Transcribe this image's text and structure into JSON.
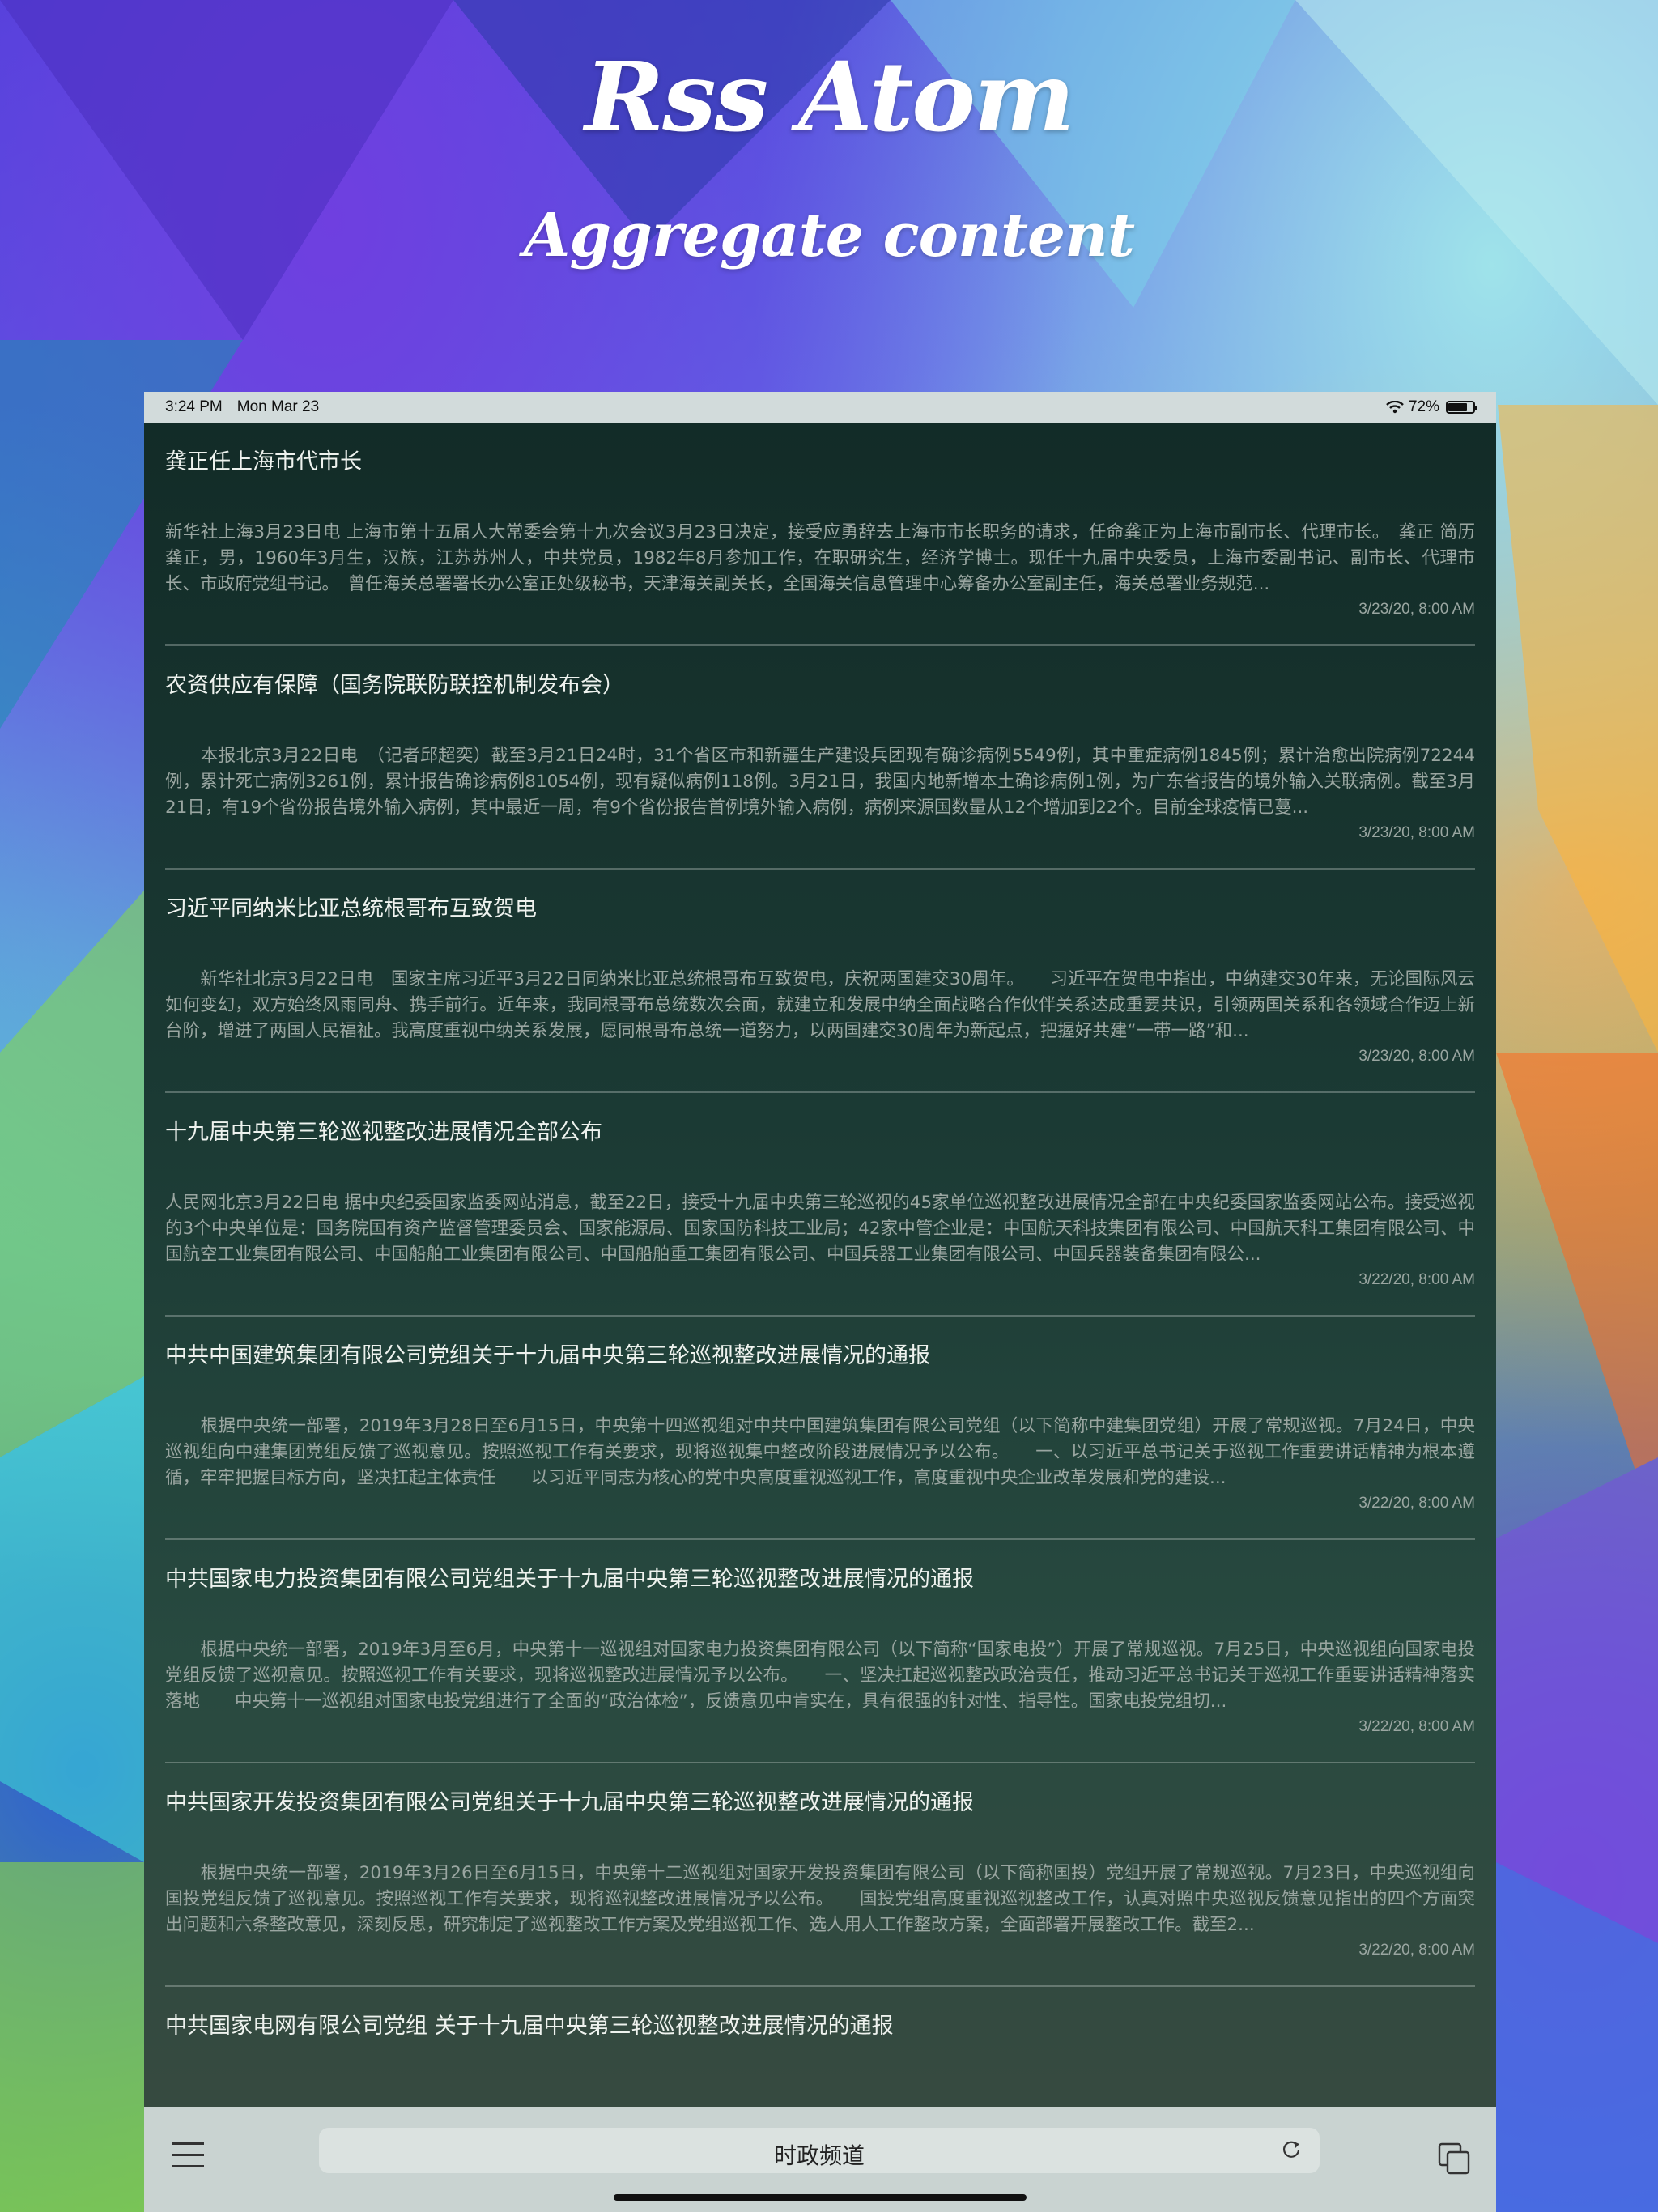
{
  "hero": {
    "title": "Rss Atom",
    "subtitle": "Aggregate content"
  },
  "status_bar": {
    "time": "3:24 PM",
    "date": "Mon Mar 23",
    "battery": "72%",
    "battery_level": 0.72
  },
  "feed": {
    "items": [
      {
        "title": "龚正任上海市代市长",
        "summary": "新华社上海3月23日电 上海市第十五届人大常委会第十九次会议3月23日决定，接受应勇辞去上海市市长职务的请求，任命龚正为上海市副市长、代理市长。　龚正 简历　　龚正，男，1960年3月生，汉族，江苏苏州人，中共党员，1982年8月参加工作，在职研究生，经济学博士。现任十九届中央委员，上海市委副书记、副市长、代理市长、市政府党组书记。　曾任海关总署署长办公室正处级秘书，天津海关副关长，全国海关信息管理中心筹备办公室副主任，海关总署业务规范...",
        "date": "3/23/20, 8:00 AM"
      },
      {
        "title": "农资供应有保障（国务院联防联控机制发布会）",
        "summary": "　　本报北京3月22日电　（记者邱超奕）截至3月21日24时，31个省区市和新疆生产建设兵团现有确诊病例5549例，其中重症病例1845例；累计治愈出院病例72244例，累计死亡病例3261例，累计报告确诊病例81054例，现有疑似病例118例。3月21日，我国内地新增本土确诊病例1例，为广东省报告的境外输入关联病例。截至3月21日，有19个省份报告境外输入病例，其中最近一周，有9个省份报告首例境外输入病例，病例来源国数量从12个增加到22个。目前全球疫情已蔓...",
        "date": "3/23/20, 8:00 AM"
      },
      {
        "title": "习近平同纳米比亚总统根哥布互致贺电",
        "summary": "　　新华社北京3月22日电　国家主席习近平3月22日同纳米比亚总统根哥布互致贺电，庆祝两国建交30周年。　　习近平在贺电中指出，中纳建交30年来，无论国际风云如何变幻，双方始终风雨同舟、携手前行。近年来，我同根哥布总统数次会面，就建立和发展中纳全面战略合作伙伴关系达成重要共识，引领两国关系和各领域合作迈上新台阶，增进了两国人民福祉。我高度重视中纳关系发展，愿同根哥布总统一道努力，以两国建交30周年为新起点，把握好共建“一带一路”和...",
        "date": "3/23/20, 8:00 AM"
      },
      {
        "title": "十九届中央第三轮巡视整改进展情况全部公布",
        "summary": "人民网北京3月22日电 据中央纪委国家监委网站消息，截至22日，接受十九届中央第三轮巡视的45家单位巡视整改进展情况全部在中央纪委国家监委网站公布。接受巡视的3个中央单位是：国务院国有资产监督管理委员会、国家能源局、国家国防科技工业局；42家中管企业是：中国航天科技集团有限公司、中国航天科工集团有限公司、中国航空工业集团有限公司、中国船舶工业集团有限公司、中国船舶重工集团有限公司、中国兵器工业集团有限公司、中国兵器装备集团有限公...",
        "date": "3/22/20, 8:00 AM"
      },
      {
        "title": "中共中国建筑集团有限公司党组关于十九届中央第三轮巡视整改进展情况的通报",
        "summary": "　　根据中央统一部署，2019年3月28日至6月15日，中央第十四巡视组对中共中国建筑集团有限公司党组（以下简称中建集团党组）开展了常规巡视。7月24日，中央巡视组向中建集团党组反馈了巡视意见。按照巡视工作有关要求，现将巡视集中整改阶段进展情况予以公布。　　一、以习近平总书记关于巡视工作重要讲话精神为根本遵循，牢牢把握目标方向，坚决扛起主体责任　　以习近平同志为核心的党中央高度重视巡视工作，高度重视中央企业改革发展和党的建设...",
        "date": "3/22/20, 8:00 AM"
      },
      {
        "title": "中共国家电力投资集团有限公司党组关于十九届中央第三轮巡视整改进展情况的通报",
        "summary": "　　根据中央统一部署，2019年3月至6月，中央第十一巡视组对国家电力投资集团有限公司（以下简称“国家电投”）开展了常规巡视。7月25日，中央巡视组向国家电投党组反馈了巡视意见。按照巡视工作有关要求，现将巡视整改进展情况予以公布。　　一、坚决扛起巡视整改政治责任，推动习近平总书记关于巡视工作重要讲话精神落实落地　　中央第十一巡视组对国家电投党组进行了全面的“政治体检”，反馈意见中肯实在，具有很强的针对性、指导性。国家电投党组切...",
        "date": "3/22/20, 8:00 AM"
      },
      {
        "title": "中共国家开发投资集团有限公司党组关于十九届中央第三轮巡视整改进展情况的通报",
        "summary": "　　根据中央统一部署，2019年3月26日至6月15日，中央第十二巡视组对国家开发投资集团有限公司（以下简称国投）党组开展了常规巡视。7月23日，中央巡视组向国投党组反馈了巡视意见。按照巡视工作有关要求，现将巡视整改进展情况予以公布。　　国投党组高度重视巡视整改工作，认真对照中央巡视反馈意见指出的四个方面突出问题和六条整改意见，深刻反思，研究制定了巡视整改工作方案及党组巡视工作、选人用人工作整改方案，全面部署开展整改工作。截至2...",
        "date": "3/22/20, 8:00 AM"
      },
      {
        "title": "中共国家电网有限公司党组 关于十九届中央第三轮巡视整改进展情况的通报"
      }
    ]
  },
  "toolbar": {
    "menu_icon": "hamburger-menu-icon",
    "channel": "时政频道",
    "refresh_icon": "refresh-icon",
    "tabs_icon": "tabs-icon"
  }
}
